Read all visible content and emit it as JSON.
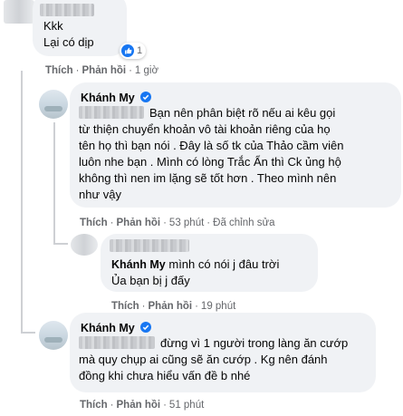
{
  "comment1": {
    "lines": [
      "Kkk",
      "Lại có dịp"
    ],
    "reaction_count": "1",
    "actions": {
      "like": "Thích",
      "reply": "Phản hồi",
      "time": "1 giờ"
    }
  },
  "reply1": {
    "author": "Khánh My",
    "lines": [
      "Bạn nên phân biệt rõ nếu ai kêu gọi",
      "từ thiện chuyển khoản vô tài khoản riêng của họ",
      "tên họ thì bạn nói . Đây là số tk của Thảo cầm viên",
      "luôn nhe bạn . Mình có lòng Trắc Ẩn thì Ck ủng hộ",
      "không thì nen im lặng sẽ tốt hơn . Theo mình nên",
      "như vậy"
    ],
    "actions": {
      "like": "Thích",
      "reply": "Phản hồi",
      "time": "53 phút",
      "edited": "Đã chỉnh sửa"
    }
  },
  "reply2": {
    "mention": "Khánh My",
    "lines": [
      "mình có nói j đâu trời",
      "Ủa bạn bị j đấy"
    ],
    "actions": {
      "like": "Thích",
      "reply": "Phản hồi",
      "time": "19 phút"
    }
  },
  "reply3": {
    "author": "Khánh My",
    "lines": [
      "đừng vì 1 người trong làng ăn cướp",
      "mà quy chụp ai cũng sẽ ăn cướp . Kg nên đánh",
      "đồng khi chưa hiểu vấn đề b nhé"
    ],
    "actions": {
      "like": "Thích",
      "reply": "Phản hồi",
      "time": "51 phút"
    }
  },
  "colors": {
    "bubble": "#f0f2f5",
    "accent": "#1877f2",
    "meta": "#65676b"
  }
}
